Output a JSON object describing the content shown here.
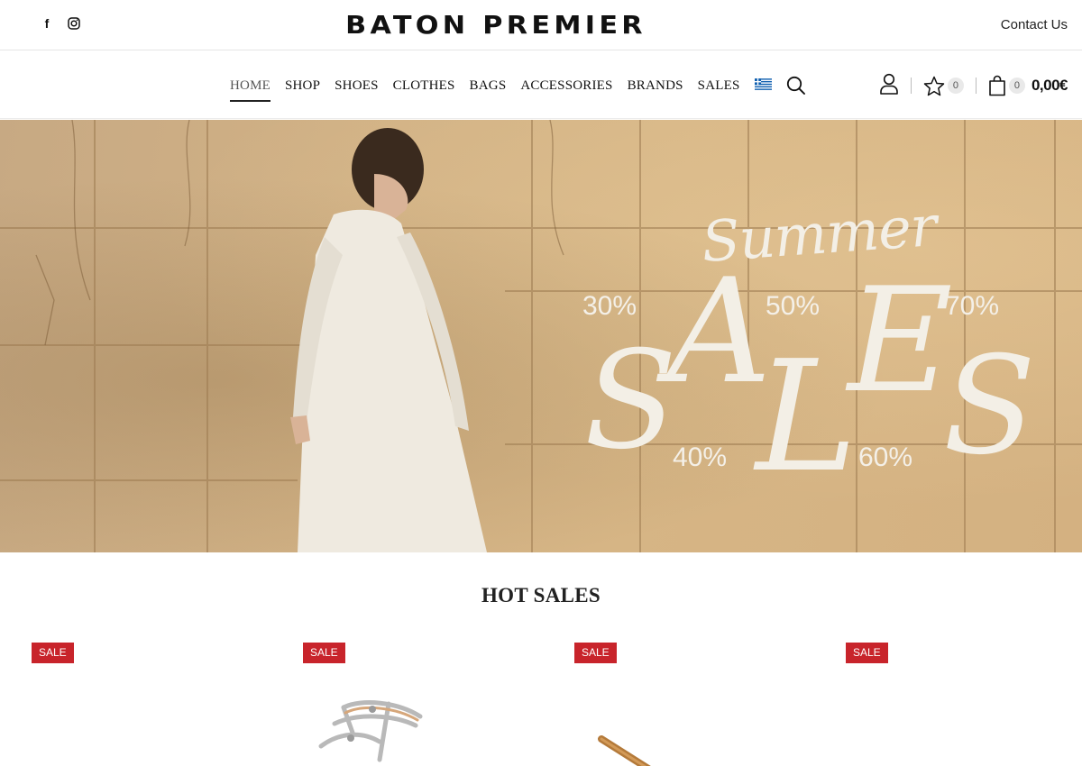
{
  "topbar": {
    "social": [
      {
        "icon": "facebook-icon",
        "glyph": "f"
      },
      {
        "icon": "instagram-icon"
      }
    ],
    "logo": "BATON PREMIER",
    "contact": "Contact Us"
  },
  "nav": {
    "items": [
      {
        "label": "HOME",
        "active": true
      },
      {
        "label": "SHOP"
      },
      {
        "label": "SHOES"
      },
      {
        "label": "CLOTHES"
      },
      {
        "label": "BAGS"
      },
      {
        "label": "ACCESSORIES"
      },
      {
        "label": "BRANDS"
      },
      {
        "label": "SALES"
      }
    ],
    "language_icon": "greek-flag-icon",
    "search_icon": "search-icon",
    "account_icon": "user-icon",
    "wishlist": {
      "icon": "star-icon",
      "count": "0"
    },
    "cart": {
      "icon": "shopping-bag-icon",
      "count": "0",
      "total": "0,00€"
    }
  },
  "hero": {
    "headline": "Summer",
    "letters": [
      "S",
      "A",
      "L",
      "E",
      "S"
    ],
    "percentages": [
      "30%",
      "50%",
      "70%",
      "40%",
      "60%"
    ]
  },
  "hot_sales": {
    "title": "HOT SALES",
    "products": [
      {
        "badge": "SALE"
      },
      {
        "badge": "SALE"
      },
      {
        "badge": "SALE"
      },
      {
        "badge": "SALE"
      }
    ]
  },
  "colors": {
    "sale_badge": "#c8242b",
    "text_dark": "#111111",
    "hero_sand": "#d2b285"
  }
}
